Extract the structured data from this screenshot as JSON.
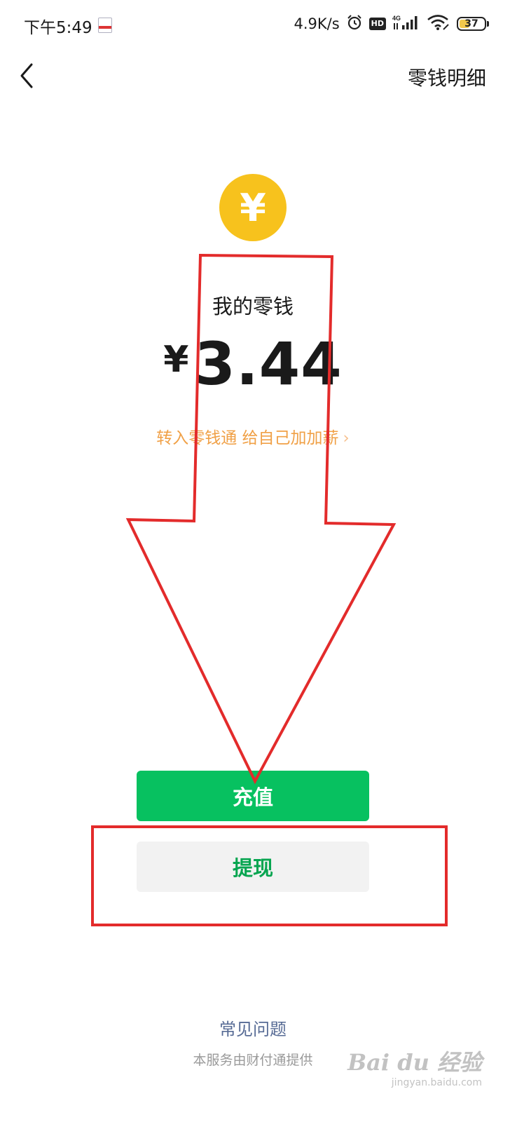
{
  "status_bar": {
    "time": "下午5:49",
    "net_speed": "4.9K/s",
    "hd_label": "HD",
    "signal_label": "4G",
    "battery": "37",
    "icons": [
      "app-notification-icon",
      "alarm-icon",
      "hd-icon",
      "signal-icon",
      "wifi-icon",
      "battery-icon"
    ]
  },
  "header": {
    "back_icon": "chevron-left-icon",
    "detail_label": "零钱明细"
  },
  "balance": {
    "coin_icon": "yen-coin-icon",
    "coin_glyph": "¥",
    "label": "我的零钱",
    "currency_symbol": "¥",
    "amount": "3.44",
    "promo_text": "转入零钱通 给自己加加薪",
    "promo_chevron": "›"
  },
  "buttons": {
    "recharge_label": "充值",
    "withdraw_label": "提现"
  },
  "footer": {
    "faq_label": "常见问题",
    "provider_text": "本服务由财付通提供"
  },
  "watermark": {
    "main": "Bai du 经验",
    "sub": "jingyan.baidu.com"
  },
  "colors": {
    "primary_green": "#07c160",
    "withdraw_text_green": "#07a550",
    "coin_yellow": "#f7c21d",
    "promo_orange": "#f0a046",
    "link_blue": "#576b95",
    "annotation_red": "#e32b2b"
  }
}
